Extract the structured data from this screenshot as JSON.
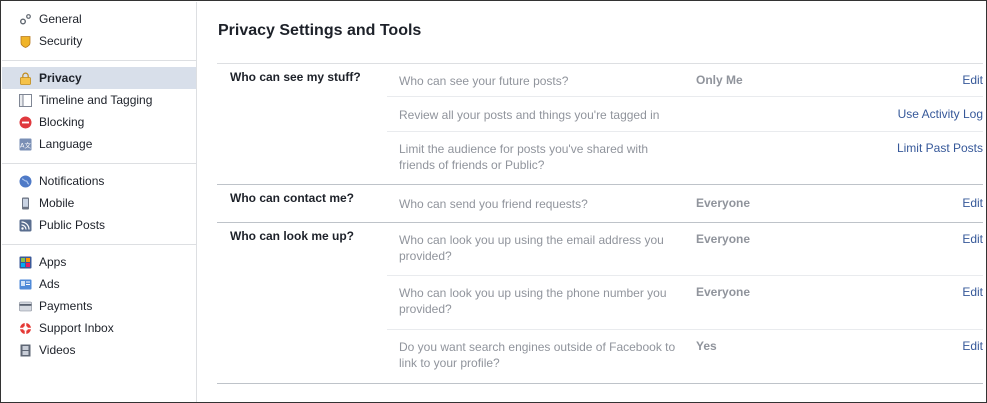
{
  "sidebar": {
    "groups": [
      [
        {
          "label": "General",
          "icon": "gears-icon"
        },
        {
          "label": "Security",
          "icon": "badge-icon"
        }
      ],
      [
        {
          "label": "Privacy",
          "icon": "lock-icon",
          "active": true
        },
        {
          "label": "Timeline and Tagging",
          "icon": "timeline-icon"
        },
        {
          "label": "Blocking",
          "icon": "blocking-icon"
        },
        {
          "label": "Language",
          "icon": "language-icon"
        }
      ],
      [
        {
          "label": "Notifications",
          "icon": "globe-icon"
        },
        {
          "label": "Mobile",
          "icon": "mobile-icon"
        },
        {
          "label": "Public Posts",
          "icon": "rss-icon"
        }
      ],
      [
        {
          "label": "Apps",
          "icon": "apps-icon"
        },
        {
          "label": "Ads",
          "icon": "ads-icon"
        },
        {
          "label": "Payments",
          "icon": "card-icon"
        },
        {
          "label": "Support Inbox",
          "icon": "lifebuoy-icon"
        },
        {
          "label": "Videos",
          "icon": "film-icon"
        }
      ]
    ]
  },
  "main": {
    "title": "Privacy Settings and Tools",
    "sections": [
      {
        "label": "Who can see my stuff?",
        "rows": [
          {
            "desc": "Who can see your future posts?",
            "value": "Only Me",
            "action": "Edit"
          },
          {
            "desc": "Review all your posts and things you're tagged in",
            "value": "",
            "action": "Use Activity Log"
          },
          {
            "desc": "Limit the audience for posts you've shared with friends of friends or Public?",
            "value": "",
            "action": "Limit Past Posts"
          }
        ]
      },
      {
        "label": "Who can contact me?",
        "rows": [
          {
            "desc": "Who can send you friend requests?",
            "value": "Everyone",
            "action": "Edit"
          }
        ]
      },
      {
        "label": "Who can look me up?",
        "rows": [
          {
            "desc": "Who can look you up using the email address you provided?",
            "value": "Everyone",
            "action": "Edit"
          },
          {
            "desc": "Who can look you up using the phone number you provided?",
            "value": "Everyone",
            "action": "Edit"
          },
          {
            "desc": "Do you want search engines outside of Facebook to link to your profile?",
            "value": "Yes",
            "action": "Edit"
          }
        ]
      }
    ]
  },
  "colors": {
    "link": "#365899",
    "muted": "#90949c",
    "active_bg": "#d8dfea",
    "divider": "#dddfe2"
  }
}
